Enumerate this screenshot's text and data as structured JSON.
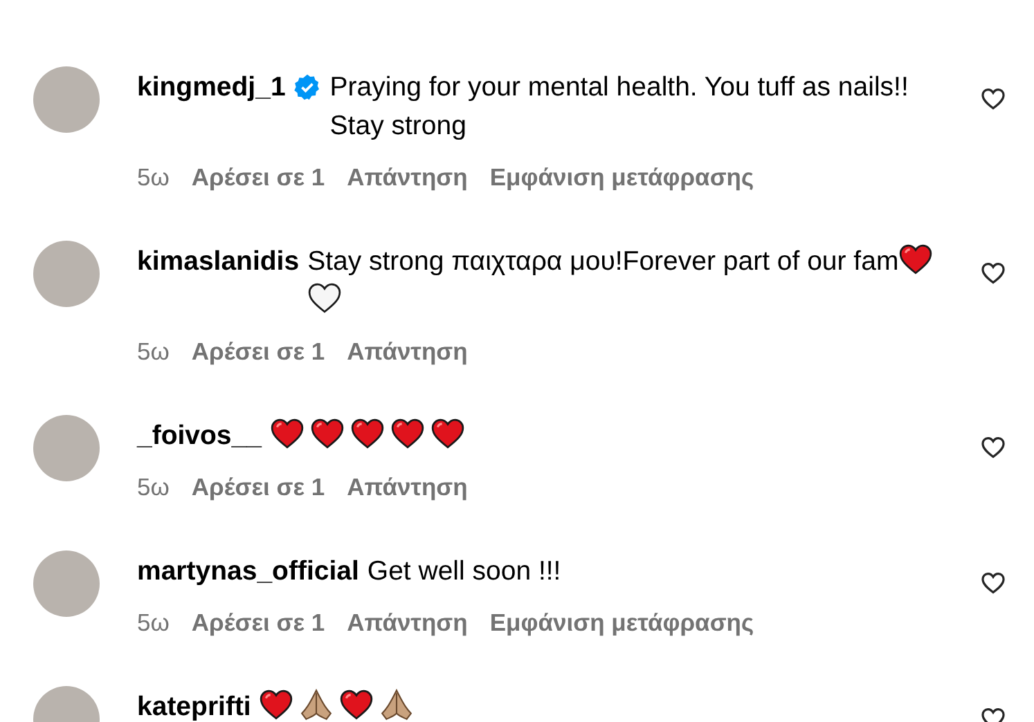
{
  "comments": [
    {
      "username": "kingmedj_1",
      "verified": true,
      "text": "Praying for your mental health. You tuff as nails!! Stay strong",
      "time": "5ω",
      "likes": "Αρέσει σε 1",
      "reply": "Απάντηση",
      "translate": "Εμφάνιση μετάφρασης"
    },
    {
      "username": "kimaslanidis",
      "text": "Stay strong παιχταρα μου!Forever part of our fam",
      "emojis": [
        {
          "kind": "red-heart"
        },
        {
          "kind": "white-heart"
        }
      ],
      "time": "5ω",
      "likes": "Αρέσει σε 1",
      "reply": "Απάντηση"
    },
    {
      "username": "_foivos__",
      "emojis": [
        {
          "kind": "red-heart"
        },
        {
          "kind": "red-heart"
        },
        {
          "kind": "red-heart"
        },
        {
          "kind": "red-heart"
        },
        {
          "kind": "red-heart"
        }
      ],
      "time": "5ω",
      "likes": "Αρέσει σε 1",
      "reply": "Απάντηση"
    },
    {
      "username": "martynas_official",
      "text": "Get well soon !!!",
      "time": "5ω",
      "likes": "Αρέσει σε 1",
      "reply": "Απάντηση",
      "translate": "Εμφάνιση μετάφρασης"
    },
    {
      "username": "kateprifti",
      "emojis": [
        {
          "kind": "red-heart"
        },
        {
          "kind": "folded-hands"
        },
        {
          "kind": "red-heart"
        },
        {
          "kind": "folded-hands"
        }
      ]
    }
  ]
}
